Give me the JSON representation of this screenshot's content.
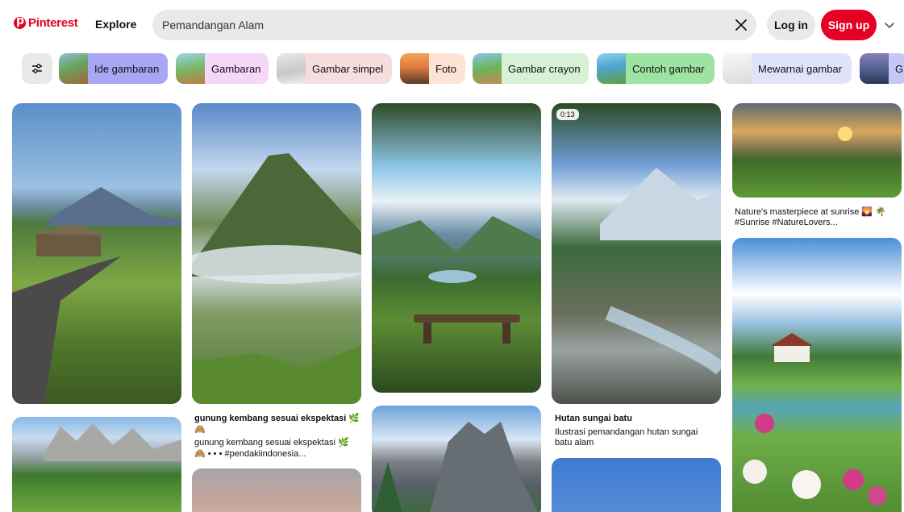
{
  "header": {
    "brand": "Pinterest",
    "explore": "Explore",
    "search_value": "Pemandangan Alam",
    "login": "Log in",
    "signup": "Sign up"
  },
  "chips": [
    {
      "label": "Ide gambaran",
      "color": "#a8a6f5"
    },
    {
      "label": "Gambaran",
      "color": "#f6d7f7"
    },
    {
      "label": "Gambar simpel",
      "color": "#f7dede"
    },
    {
      "label": "Foto",
      "color": "#fde3d6"
    },
    {
      "label": "Gambar crayon",
      "color": "#d6f1d5"
    },
    {
      "label": "Contoh gambar",
      "color": "#9ee3a3"
    },
    {
      "label": "Mewarnai gambar",
      "color": "#dfe4fb"
    },
    {
      "label": "G",
      "color": "#c5c8f7"
    }
  ],
  "pins": [
    {
      "title": "",
      "desc": ""
    },
    {
      "title": "gunung kembang sesuai ekspektasi 🌿",
      "title2": "🙈",
      "desc": "gunung kembang sesuai ekspektasi 🌿",
      "desc2": "🙈 • • • #pendakiindonesia..."
    },
    {
      "title": "",
      "desc": ""
    },
    {
      "title": "Hutan sungai batu",
      "desc": "Ilustrasi pemandangan hutan sungai",
      "desc2": "batu alam",
      "badge": "0:13"
    },
    {
      "title": "",
      "desc": "Nature's masterpiece at sunrise 🌄 🌴",
      "desc2": "#Sunrise #NatureLovers..."
    }
  ],
  "colors": {
    "accent": "#e60023"
  }
}
